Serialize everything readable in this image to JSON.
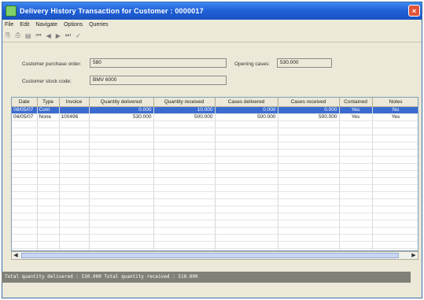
{
  "window": {
    "title": "Delivery History Transaction for Customer : 0000017",
    "close_glyph": "×"
  },
  "menu": [
    "File",
    "Edit",
    "Navigate",
    "Options",
    "Queries"
  ],
  "toolbar": {
    "items": [
      "⎘",
      "⎙",
      "▤",
      "⏮",
      "◀",
      "▶",
      "⏭",
      "✓"
    ]
  },
  "fields": {
    "customer_po_label": "Customer purchase order:",
    "customer_po_value": "580",
    "customer_stock_label": "Customer stock code:",
    "customer_stock_value": "BMV 6000",
    "opening_cases_label": "Opening cases:",
    "opening_cases_value": "530.000"
  },
  "table": {
    "columns": [
      "Date",
      "Type",
      "Invoice",
      "Quantity delivered",
      "Quantity received",
      "Cases delivered",
      "Cases received",
      "Contained",
      "Notes"
    ],
    "rows": [
      [
        "08/05/07",
        "Cont",
        "",
        "0.000",
        "10.000",
        "0.000",
        "0.000",
        "Yes",
        "No"
      ],
      [
        "04/05/07",
        "None",
        "100496",
        "530.000",
        "500.000",
        "500.000",
        "500.000",
        "Yes",
        "Yes"
      ]
    ],
    "selected_row": 0
  },
  "status": {
    "text": "Total quantity delivered :     530.000          Total quantity received :      510.000"
  },
  "scroll": {
    "left": "◀",
    "right": "▶"
  }
}
